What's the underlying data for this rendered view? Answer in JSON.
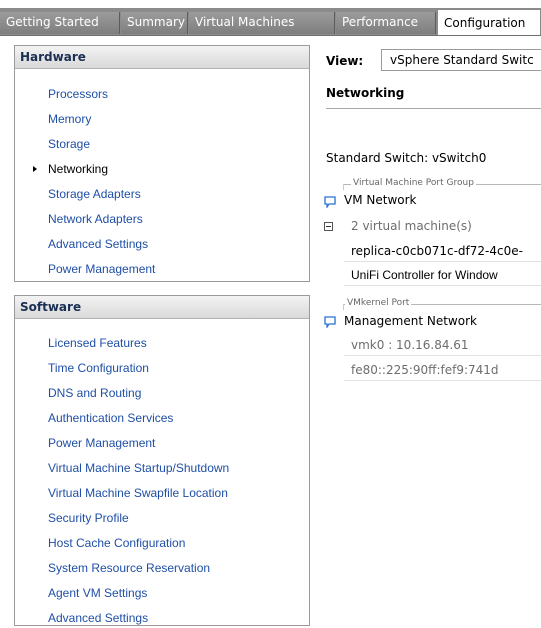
{
  "tabs": [
    {
      "label": "Getting Started"
    },
    {
      "label": "Summary"
    },
    {
      "label": "Virtual Machines"
    },
    {
      "label": "Performance"
    },
    {
      "label": "Configuration"
    }
  ],
  "hardware": {
    "title": "Hardware",
    "items": [
      {
        "label": "Processors"
      },
      {
        "label": "Memory"
      },
      {
        "label": "Storage"
      },
      {
        "label": "Networking"
      },
      {
        "label": "Storage Adapters"
      },
      {
        "label": "Network Adapters"
      },
      {
        "label": "Advanced Settings"
      },
      {
        "label": "Power Management"
      }
    ],
    "selected": "Networking"
  },
  "software": {
    "title": "Software",
    "items": [
      {
        "label": "Licensed Features"
      },
      {
        "label": "Time Configuration"
      },
      {
        "label": "DNS and Routing"
      },
      {
        "label": "Authentication Services"
      },
      {
        "label": "Power Management"
      },
      {
        "label": "Virtual Machine Startup/Shutdown"
      },
      {
        "label": "Virtual Machine Swapfile Location"
      },
      {
        "label": "Security Profile"
      },
      {
        "label": "Host Cache Configuration"
      },
      {
        "label": "System Resource Reservation"
      },
      {
        "label": "Agent VM Settings"
      },
      {
        "label": "Advanced Settings"
      }
    ]
  },
  "main": {
    "view_label": "View:",
    "view_value": "vSphere Standard Switc",
    "section_title": "Networking",
    "switch_title": "Standard Switch: vSwitch0",
    "vm_group": {
      "caption": "Virtual Machine Port Group",
      "name": "VM Network",
      "vm_count": "2 virtual machine(s)",
      "vms": [
        "replica-c0cb071c-df72-4c0e-",
        "UniFi Controller for Window"
      ]
    },
    "vmk_group": {
      "caption": "VMkernel Port",
      "name": "Management Network",
      "ipv4": "vmk0 : 10.16.84.61",
      "ipv6": "fe80::225:90ff:fef9:741d"
    }
  },
  "colors": {
    "link": "#1f4fa6",
    "header_text": "#1b2f52",
    "tab_bg": "#8b8b8b"
  }
}
